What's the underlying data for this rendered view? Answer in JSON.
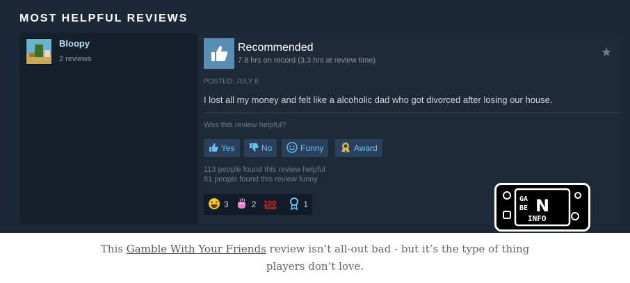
{
  "section": {
    "title": "MOST HELPFUL REVIEWS"
  },
  "author": {
    "name": "Bloopy",
    "reviews": "2 reviews"
  },
  "review": {
    "verdict": "Recommended",
    "hours": "7.8 hrs on record (3.3 hrs at review time)",
    "posted": "POSTED: JULY 8",
    "text": "I lost all my money and felt like a alcoholic dad who got divorced after losing our house.",
    "helpful_question": "Was this review helpful?",
    "buttons": {
      "yes": "Yes",
      "no": "No",
      "funny": "Funny",
      "award": "Award"
    },
    "stats": {
      "helpful": "113 people found this review helpful",
      "funny": "81 people found this review funny"
    },
    "awards": [
      {
        "icon": "laughing-emoji-icon",
        "count": "3"
      },
      {
        "icon": "hot-beverage-icon",
        "count": "2"
      },
      {
        "icon": "hundred-points-icon",
        "count": ""
      },
      {
        "icon": "ribbon-award-icon",
        "count": "1"
      }
    ]
  },
  "watermark": {
    "lines": [
      "GA",
      "BE",
      "N",
      "INFO"
    ]
  },
  "caption": {
    "before": "This ",
    "link": "Gamble With Your Friends",
    "after": " review isn’t all-out bad - but it’s the type of thing players don’t love."
  },
  "colors": {
    "background": "#1b2838",
    "accent": "#67c1f5",
    "thumb": "#5a8db4"
  }
}
